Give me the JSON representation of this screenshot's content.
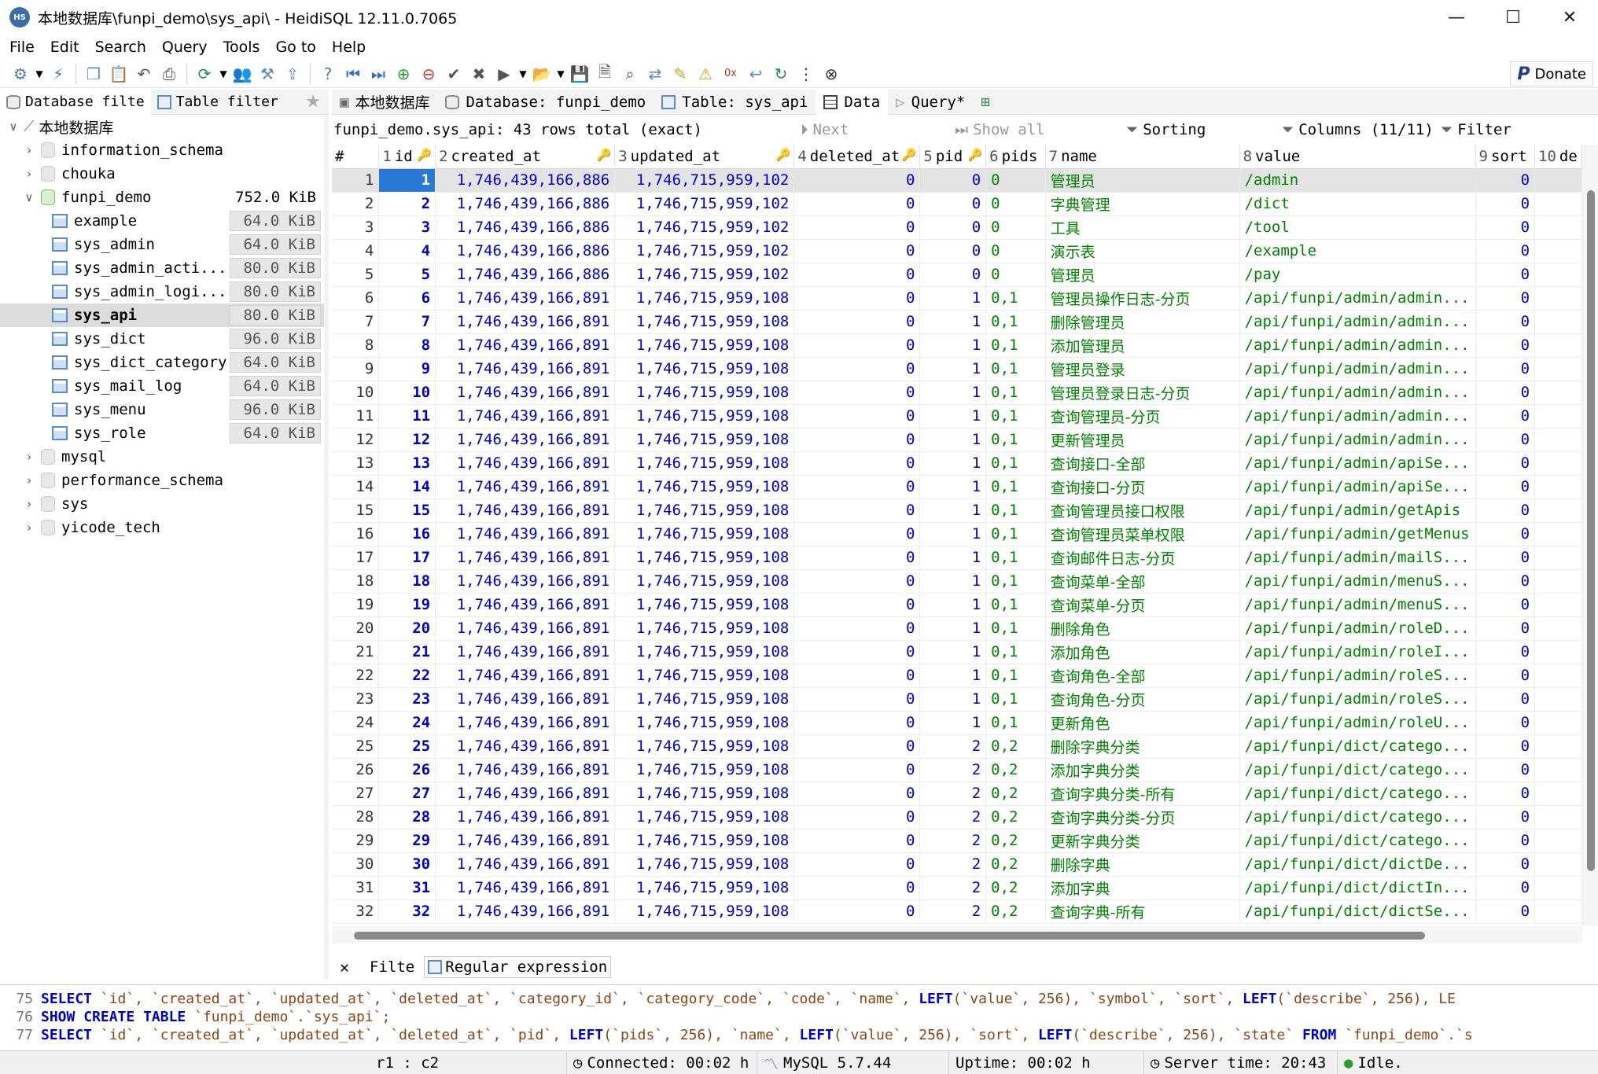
{
  "window": {
    "title": "本地数据库\\funpi_demo\\sys_api\\ - HeidiSQL 12.11.0.7065",
    "app_icon": "HS",
    "buttons": [
      "minimize-icon",
      "maximize-icon",
      "close-icon"
    ]
  },
  "menu": [
    "File",
    "Edit",
    "Search",
    "Query",
    "Tools",
    "Go to",
    "Help"
  ],
  "toolbar": {
    "donate_label": "Donate"
  },
  "left_tabs": {
    "database_filter": "Database filte",
    "table_filter": "Table filter"
  },
  "tree": {
    "root": "本地数据库",
    "databases": [
      {
        "name": "information_schema"
      },
      {
        "name": "chouka"
      },
      {
        "name": "funpi_demo",
        "size": "752.0 KiB"
      },
      {
        "name": "mysql"
      },
      {
        "name": "performance_schema"
      },
      {
        "name": "sys"
      },
      {
        "name": "yicode_tech"
      }
    ],
    "tables": [
      {
        "name": "example",
        "size": "64.0 KiB"
      },
      {
        "name": "sys_admin",
        "size": "64.0 KiB"
      },
      {
        "name": "sys_admin_acti...",
        "size": "80.0 KiB"
      },
      {
        "name": "sys_admin_logi...",
        "size": "80.0 KiB"
      },
      {
        "name": "sys_api",
        "size": "80.0 KiB"
      },
      {
        "name": "sys_dict",
        "size": "96.0 KiB"
      },
      {
        "name": "sys_dict_category",
        "size": "64.0 KiB"
      },
      {
        "name": "sys_mail_log",
        "size": "64.0 KiB"
      },
      {
        "name": "sys_menu",
        "size": "96.0 KiB"
      },
      {
        "name": "sys_role",
        "size": "64.0 KiB"
      }
    ]
  },
  "tabs": {
    "host": "本地数据库",
    "database": "Database: funpi_demo",
    "table": "Table: sys_api",
    "data": "Data",
    "query": "Query*"
  },
  "data_bar": {
    "rows_info": "funpi_demo.sys_api: 43 rows total (exact)",
    "next": "Next",
    "show_all": "Show all",
    "sorting": "Sorting",
    "columns": "Columns (11/11)",
    "filter": "Filter"
  },
  "grid": {
    "columns": [
      {
        "num": "#",
        "name": ""
      },
      {
        "num": "1",
        "name": "id"
      },
      {
        "num": "2",
        "name": "created_at"
      },
      {
        "num": "3",
        "name": "updated_at"
      },
      {
        "num": "4",
        "name": "deleted_at"
      },
      {
        "num": "5",
        "name": "pid"
      },
      {
        "num": "6",
        "name": "pids"
      },
      {
        "num": "7",
        "name": "name"
      },
      {
        "num": "8",
        "name": "value"
      },
      {
        "num": "9",
        "name": "sort"
      },
      {
        "num": "10",
        "name": "de"
      }
    ],
    "rows": [
      [
        "1",
        "1",
        "1,746,439,166,886",
        "1,746,715,959,102",
        "0",
        "0",
        "0",
        "管理员",
        "/admin",
        "0"
      ],
      [
        "2",
        "2",
        "1,746,439,166,886",
        "1,746,715,959,102",
        "0",
        "0",
        "0",
        "字典管理",
        "/dict",
        "0"
      ],
      [
        "3",
        "3",
        "1,746,439,166,886",
        "1,746,715,959,102",
        "0",
        "0",
        "0",
        "工具",
        "/tool",
        "0"
      ],
      [
        "4",
        "4",
        "1,746,439,166,886",
        "1,746,715,959,102",
        "0",
        "0",
        "0",
        "演示表",
        "/example",
        "0"
      ],
      [
        "5",
        "5",
        "1,746,439,166,886",
        "1,746,715,959,102",
        "0",
        "0",
        "0",
        "管理员",
        "/pay",
        "0"
      ],
      [
        "6",
        "6",
        "1,746,439,166,891",
        "1,746,715,959,108",
        "0",
        "1",
        "0,1",
        "管理员操作日志-分页",
        "/api/funpi/admin/admin...",
        "0"
      ],
      [
        "7",
        "7",
        "1,746,439,166,891",
        "1,746,715,959,108",
        "0",
        "1",
        "0,1",
        "删除管理员",
        "/api/funpi/admin/admin...",
        "0"
      ],
      [
        "8",
        "8",
        "1,746,439,166,891",
        "1,746,715,959,108",
        "0",
        "1",
        "0,1",
        "添加管理员",
        "/api/funpi/admin/admin...",
        "0"
      ],
      [
        "9",
        "9",
        "1,746,439,166,891",
        "1,746,715,959,108",
        "0",
        "1",
        "0,1",
        "管理员登录",
        "/api/funpi/admin/admin...",
        "0"
      ],
      [
        "10",
        "10",
        "1,746,439,166,891",
        "1,746,715,959,108",
        "0",
        "1",
        "0,1",
        "管理员登录日志-分页",
        "/api/funpi/admin/admin...",
        "0"
      ],
      [
        "11",
        "11",
        "1,746,439,166,891",
        "1,746,715,959,108",
        "0",
        "1",
        "0,1",
        "查询管理员-分页",
        "/api/funpi/admin/admin...",
        "0"
      ],
      [
        "12",
        "12",
        "1,746,439,166,891",
        "1,746,715,959,108",
        "0",
        "1",
        "0,1",
        "更新管理员",
        "/api/funpi/admin/admin...",
        "0"
      ],
      [
        "13",
        "13",
        "1,746,439,166,891",
        "1,746,715,959,108",
        "0",
        "1",
        "0,1",
        "查询接口-全部",
        "/api/funpi/admin/apiSe...",
        "0"
      ],
      [
        "14",
        "14",
        "1,746,439,166,891",
        "1,746,715,959,108",
        "0",
        "1",
        "0,1",
        "查询接口-分页",
        "/api/funpi/admin/apiSe...",
        "0"
      ],
      [
        "15",
        "15",
        "1,746,439,166,891",
        "1,746,715,959,108",
        "0",
        "1",
        "0,1",
        "查询管理员接口权限",
        "/api/funpi/admin/getApis",
        "0"
      ],
      [
        "16",
        "16",
        "1,746,439,166,891",
        "1,746,715,959,108",
        "0",
        "1",
        "0,1",
        "查询管理员菜单权限",
        "/api/funpi/admin/getMenus",
        "0"
      ],
      [
        "17",
        "17",
        "1,746,439,166,891",
        "1,746,715,959,108",
        "0",
        "1",
        "0,1",
        "查询邮件日志-分页",
        "/api/funpi/admin/mailS...",
        "0"
      ],
      [
        "18",
        "18",
        "1,746,439,166,891",
        "1,746,715,959,108",
        "0",
        "1",
        "0,1",
        "查询菜单-全部",
        "/api/funpi/admin/menuS...",
        "0"
      ],
      [
        "19",
        "19",
        "1,746,439,166,891",
        "1,746,715,959,108",
        "0",
        "1",
        "0,1",
        "查询菜单-分页",
        "/api/funpi/admin/menuS...",
        "0"
      ],
      [
        "20",
        "20",
        "1,746,439,166,891",
        "1,746,715,959,108",
        "0",
        "1",
        "0,1",
        "删除角色",
        "/api/funpi/admin/roleD...",
        "0"
      ],
      [
        "21",
        "21",
        "1,746,439,166,891",
        "1,746,715,959,108",
        "0",
        "1",
        "0,1",
        "添加角色",
        "/api/funpi/admin/roleI...",
        "0"
      ],
      [
        "22",
        "22",
        "1,746,439,166,891",
        "1,746,715,959,108",
        "0",
        "1",
        "0,1",
        "查询角色-全部",
        "/api/funpi/admin/roleS...",
        "0"
      ],
      [
        "23",
        "23",
        "1,746,439,166,891",
        "1,746,715,959,108",
        "0",
        "1",
        "0,1",
        "查询角色-分页",
        "/api/funpi/admin/roleS...",
        "0"
      ],
      [
        "24",
        "24",
        "1,746,439,166,891",
        "1,746,715,959,108",
        "0",
        "1",
        "0,1",
        "更新角色",
        "/api/funpi/admin/roleU...",
        "0"
      ],
      [
        "25",
        "25",
        "1,746,439,166,891",
        "1,746,715,959,108",
        "0",
        "2",
        "0,2",
        "删除字典分类",
        "/api/funpi/dict/catego...",
        "0"
      ],
      [
        "26",
        "26",
        "1,746,439,166,891",
        "1,746,715,959,108",
        "0",
        "2",
        "0,2",
        "添加字典分类",
        "/api/funpi/dict/catego...",
        "0"
      ],
      [
        "27",
        "27",
        "1,746,439,166,891",
        "1,746,715,959,108",
        "0",
        "2",
        "0,2",
        "查询字典分类-所有",
        "/api/funpi/dict/catego...",
        "0"
      ],
      [
        "28",
        "28",
        "1,746,439,166,891",
        "1,746,715,959,108",
        "0",
        "2",
        "0,2",
        "查询字典分类-分页",
        "/api/funpi/dict/catego...",
        "0"
      ],
      [
        "29",
        "29",
        "1,746,439,166,891",
        "1,746,715,959,108",
        "0",
        "2",
        "0,2",
        "更新字典分类",
        "/api/funpi/dict/catego...",
        "0"
      ],
      [
        "30",
        "30",
        "1,746,439,166,891",
        "1,746,715,959,108",
        "0",
        "2",
        "0,2",
        "删除字典",
        "/api/funpi/dict/dictDe...",
        "0"
      ],
      [
        "31",
        "31",
        "1,746,439,166,891",
        "1,746,715,959,108",
        "0",
        "2",
        "0,2",
        "添加字典",
        "/api/funpi/dict/dictIn...",
        "0"
      ],
      [
        "32",
        "32",
        "1,746,439,166,891",
        "1,746,715,959,108",
        "0",
        "2",
        "0,2",
        "查询字典-所有",
        "/api/funpi/dict/dictSe...",
        "0"
      ]
    ]
  },
  "filter_bar": {
    "filter_label": "Filte",
    "regex_label": "Regular expression"
  },
  "sql_log": [
    {
      "line": "75",
      "text": "SELECT `id`, `created_at`, `updated_at`, `deleted_at`, `category_id`, `category_code`, `code`, `name`, LEFT(`value`, 256), `symbol`, `sort`, LEFT(`describe`, 256), LE"
    },
    {
      "line": "76",
      "text": "SHOW CREATE TABLE `funpi_demo`.`sys_api`;"
    },
    {
      "line": "77",
      "text": "SELECT `id`, `created_at`, `updated_at`, `deleted_at`, `pid`, LEFT(`pids`, 256), `name`, LEFT(`value`, 256), `sort`, LEFT(`describe`, 256), `state` FROM `funpi_demo`.`s"
    }
  ],
  "status": {
    "position": "r1 : c2",
    "connected": "Connected: 00:02 h",
    "server": "MySQL 5.7.44",
    "uptime": "Uptime: 00:02 h",
    "server_time": "Server time: 20:43",
    "state": "Idle."
  }
}
